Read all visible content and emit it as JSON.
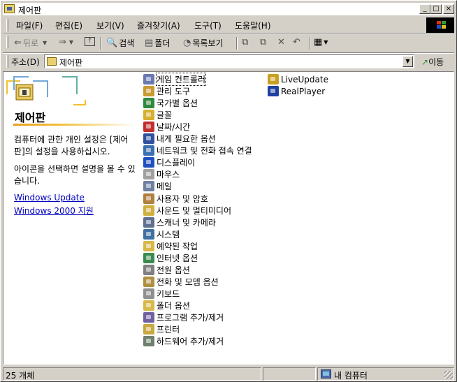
{
  "window": {
    "title": "제어판"
  },
  "menu": [
    "파일(F)",
    "편집(E)",
    "보기(V)",
    "즐겨찾기(A)",
    "도구(T)",
    "도움말(H)"
  ],
  "toolbar": {
    "back": "뒤로",
    "search": "검색",
    "folders": "폴더",
    "history": "목록보기"
  },
  "address": {
    "label": "주소(D)",
    "value": "제어판",
    "go": "이동"
  },
  "panel": {
    "title": "제어판",
    "description": "컴퓨터에 관한 개인 설정은 [제어판]의 설정을 사용하십시오.",
    "hint": "아이콘을 선택하면 설명을 볼 수 있습니다.",
    "links": [
      "Windows Update",
      "Windows 2000 지원"
    ]
  },
  "items_col1": [
    {
      "label": "게임 컨트롤러",
      "color": "#6a7ab0"
    },
    {
      "label": "관리 도구",
      "color": "#c89a30"
    },
    {
      "label": "국가별 옵션",
      "color": "#2e8a3e"
    },
    {
      "label": "글꼴",
      "color": "#d6b030"
    },
    {
      "label": "날짜/시간",
      "color": "#c03030"
    },
    {
      "label": "내게 필요한 옵션",
      "color": "#3050a0"
    },
    {
      "label": "네트워크 및 전화 접속 연결",
      "color": "#3a70b0"
    },
    {
      "label": "디스플레이",
      "color": "#2050c0"
    },
    {
      "label": "마우스",
      "color": "#a0a0a0"
    },
    {
      "label": "메일",
      "color": "#7080a0"
    },
    {
      "label": "사용자 및 암호",
      "color": "#b08040"
    },
    {
      "label": "사운드 및 멀티미디어",
      "color": "#d0b040"
    },
    {
      "label": "스캐너 및 카메라",
      "color": "#607090"
    },
    {
      "label": "시스템",
      "color": "#4070a0"
    },
    {
      "label": "예약된 작업",
      "color": "#d8b848"
    },
    {
      "label": "인터넷 옵션",
      "color": "#3a8a50"
    },
    {
      "label": "전원 옵션",
      "color": "#808080"
    },
    {
      "label": "전화 및 모뎀 옵션",
      "color": "#b09040"
    },
    {
      "label": "키보드",
      "color": "#909090"
    },
    {
      "label": "폴더 옵션",
      "color": "#d8b848"
    },
    {
      "label": "프로그램 추가/제거",
      "color": "#7060a0"
    },
    {
      "label": "프린터",
      "color": "#c8a840"
    },
    {
      "label": "하드웨어 추가/제거",
      "color": "#708070"
    }
  ],
  "items_col2": [
    {
      "label": "LiveUpdate",
      "color": "#c8a020"
    },
    {
      "label": "RealPlayer",
      "color": "#2040a0"
    }
  ],
  "status": {
    "count": "25 개체",
    "location": "내 컴퓨터"
  }
}
